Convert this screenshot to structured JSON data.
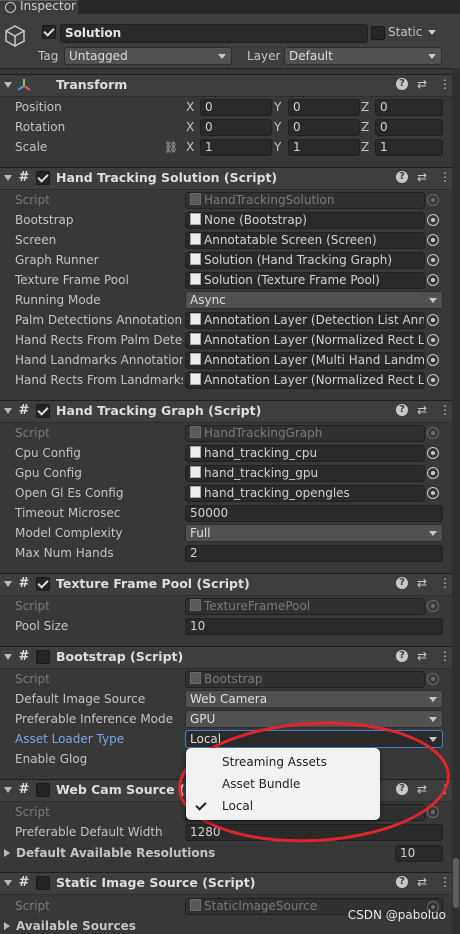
{
  "tab": {
    "label": "Inspector"
  },
  "object": {
    "name": "Solution",
    "active": true,
    "static_label": "Static",
    "static": false,
    "tag_label": "Tag",
    "tag_value": "Untagged",
    "layer_label": "Layer",
    "layer_value": "Default"
  },
  "transform": {
    "title": "Transform",
    "position_label": "Position",
    "rotation_label": "Rotation",
    "scale_label": "Scale",
    "axis_x": "X",
    "axis_y": "Y",
    "axis_z": "Z",
    "position": [
      "0",
      "0",
      "0"
    ],
    "rotation": [
      "0",
      "0",
      "0"
    ],
    "scale": [
      "1",
      "1",
      "1"
    ]
  },
  "hand_tracking_solution": {
    "title": "Hand Tracking Solution (Script)",
    "enabled": true,
    "rows": [
      {
        "label": "Script",
        "value": "HandTrackingSolution",
        "kind": "script"
      },
      {
        "label": "Bootstrap",
        "value": "None (Bootstrap)",
        "kind": "object"
      },
      {
        "label": "Screen",
        "value": "Annotatable Screen (Screen)",
        "kind": "object"
      },
      {
        "label": "Graph Runner",
        "value": "Solution (Hand Tracking Graph)",
        "kind": "object"
      },
      {
        "label": "Texture Frame Pool",
        "value": "Solution (Texture Frame Pool)",
        "kind": "object"
      },
      {
        "label": "Running Mode",
        "value": "Async",
        "kind": "dropdown"
      },
      {
        "label": "Palm Detections Annotation C",
        "value": "Annotation Layer (Detection List Annota",
        "kind": "object"
      },
      {
        "label": "Hand Rects From Palm Detect",
        "value": "Annotation Layer (Normalized Rect List",
        "kind": "object"
      },
      {
        "label": "Hand Landmarks Annotation C",
        "value": "Annotation Layer (Multi Hand Landmark",
        "kind": "object"
      },
      {
        "label": "Hand Rects From Landmarks A",
        "value": "Annotation Layer (Normalized Rect List",
        "kind": "object"
      }
    ]
  },
  "hand_tracking_graph": {
    "title": "Hand Tracking Graph (Script)",
    "enabled": true,
    "rows": [
      {
        "label": "Script",
        "value": "HandTrackingGraph",
        "kind": "script"
      },
      {
        "label": "Cpu Config",
        "value": "hand_tracking_cpu",
        "kind": "object"
      },
      {
        "label": "Gpu Config",
        "value": "hand_tracking_gpu",
        "kind": "object"
      },
      {
        "label": "Open Gl Es Config",
        "value": "hand_tracking_opengles",
        "kind": "object"
      },
      {
        "label": "Timeout Microsec",
        "value": "50000",
        "kind": "text"
      },
      {
        "label": "Model Complexity",
        "value": "Full",
        "kind": "dropdown"
      },
      {
        "label": "Max Num Hands",
        "value": "2",
        "kind": "text"
      }
    ]
  },
  "texture_frame_pool": {
    "title": "Texture Frame Pool (Script)",
    "enabled": true,
    "rows": [
      {
        "label": "Script",
        "value": "TextureFramePool",
        "kind": "script"
      },
      {
        "label": "Pool Size",
        "value": "10",
        "kind": "text"
      }
    ]
  },
  "bootstrap": {
    "title": "Bootstrap (Script)",
    "enabled": false,
    "rows": [
      {
        "label": "Script",
        "value": "Bootstrap",
        "kind": "script"
      },
      {
        "label": "Default Image Source",
        "value": "Web Camera",
        "kind": "dropdown"
      },
      {
        "label": "Preferable Inference Mode",
        "value": "GPU",
        "kind": "dropdown"
      },
      {
        "label": "Asset Loader Type",
        "value": "Local",
        "kind": "dropdown-open"
      },
      {
        "label": "Enable Glog",
        "value": "",
        "kind": "none"
      }
    ],
    "asset_loader_options": [
      "Streaming Assets",
      "Asset Bundle",
      "Local"
    ],
    "asset_loader_selected": "Local"
  },
  "web_cam_source": {
    "title": "Web Cam Source (Script)",
    "title_visible": "Web Cam Source (Scri",
    "enabled": false,
    "rows": [
      {
        "label": "Script",
        "value": "",
        "kind": "script"
      },
      {
        "label": "Preferable Default Width",
        "value": "1280",
        "kind": "text"
      }
    ],
    "resolutions_label": "Default Available Resolutions",
    "resolutions_count": "10",
    "partial_value": "0"
  },
  "static_image_source": {
    "title": "Static Image Source (Script)",
    "enabled": false,
    "script_label": "Script",
    "script_value": "StaticImageSource",
    "available_label": "Available Sources"
  },
  "watermark": "CSDN @paboluo",
  "colors": {
    "background": "#383838",
    "header": "#3e3e3e",
    "field": "#2a2a2a",
    "annotation": "#e4242b",
    "link_label": "#7ba7e6"
  }
}
